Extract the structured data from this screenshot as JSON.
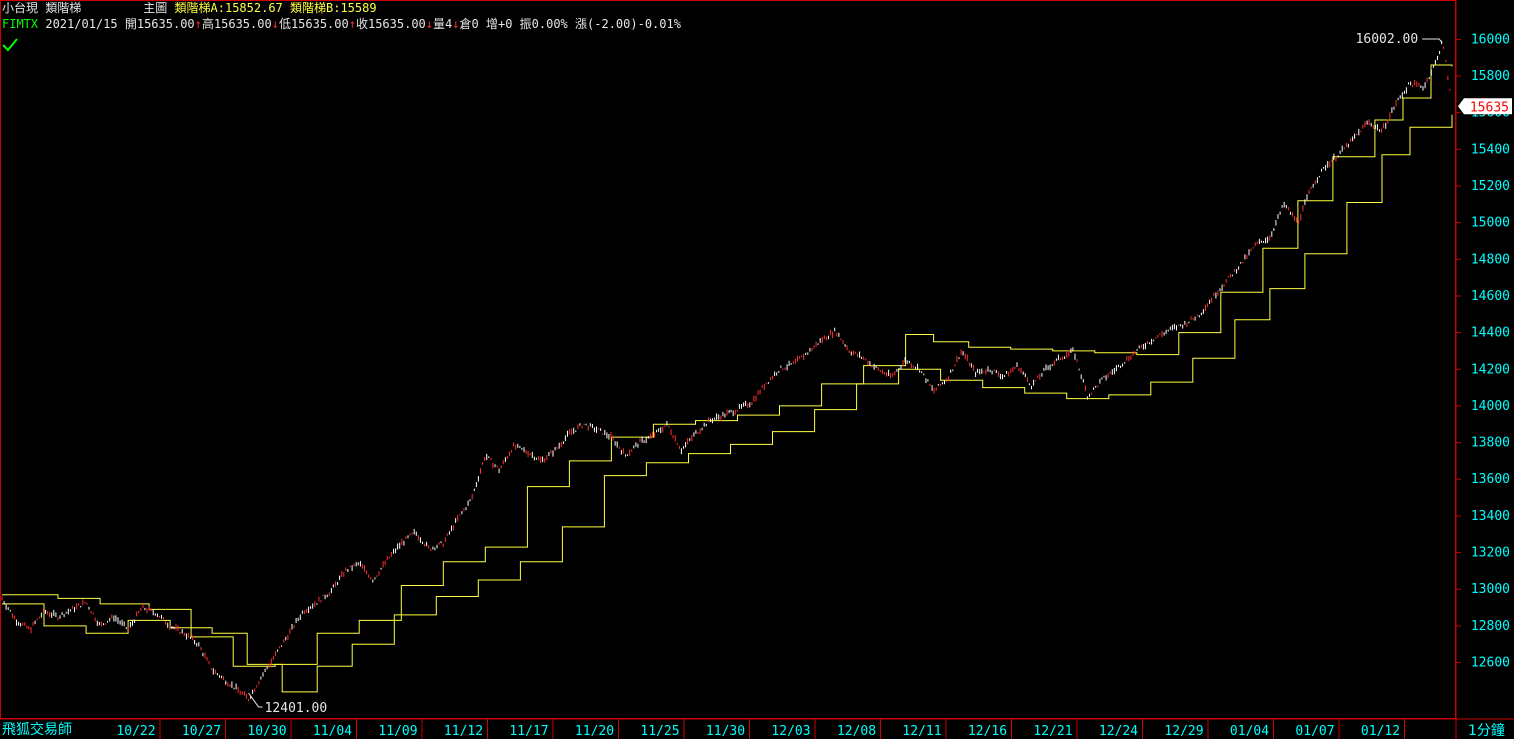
{
  "header": {
    "symbol_name": "小台現",
    "indicator_name": "類階梯",
    "panel_label": "主圖",
    "ladder_a": "類階梯A:15852.67",
    "ladder_b": "類階梯B:15589",
    "code": "FIMTX",
    "date": "2021/01/15",
    "open": "開15635.00",
    "high": "高15635.00",
    "low": "低15635.00",
    "close": "收15635.00",
    "volume": "量4",
    "oi": "倉0",
    "oi_change": "增+0",
    "amplitude": "振0.00%",
    "change": "漲(-2.00)-0.01%"
  },
  "footer": {
    "brand": "飛狐交易師",
    "interval": "1分鐘"
  },
  "colors": {
    "background": "#000000",
    "frame": "#cc0000",
    "axis_text": "#00ffff",
    "ladder_line": "#ffff40",
    "bar_up": "#ffffff",
    "bar_down": "#ff3030",
    "last_price_bg": "#ffffff",
    "last_price_text": "#ff0000",
    "check_icon": "#00ff00"
  },
  "chart_data": {
    "type": "line",
    "ylim": [
      12401,
      16002
    ],
    "y_ticks": [
      12600,
      12800,
      13000,
      13200,
      13400,
      13600,
      13800,
      14000,
      14200,
      14400,
      14600,
      14800,
      15000,
      15200,
      15400,
      15600,
      15800,
      16000
    ],
    "x_tick_labels": [
      "10/22",
      "10/27",
      "10/30",
      "11/04",
      "11/09",
      "11/12",
      "11/17",
      "11/20",
      "11/25",
      "11/30",
      "12/03",
      "12/08",
      "12/11",
      "12/16",
      "12/21",
      "12/24",
      "12/29",
      "01/04",
      "01/07",
      "01/12"
    ],
    "annotations": {
      "max_label": "16002.00",
      "min_label": "12401.00",
      "last_price_label": "15635"
    },
    "series": [
      {
        "name": "類階梯A",
        "steps": [
          [
            0,
            12970
          ],
          [
            4,
            12950
          ],
          [
            7,
            12920
          ],
          [
            10.5,
            12890
          ],
          [
            13.5,
            12740
          ],
          [
            16.5,
            12580
          ],
          [
            19.5,
            12590
          ],
          [
            22.5,
            12760
          ],
          [
            25.5,
            12830
          ],
          [
            28.5,
            13020
          ],
          [
            31.5,
            13150
          ],
          [
            34.5,
            13230
          ],
          [
            37.5,
            13560
          ],
          [
            40.5,
            13700
          ],
          [
            43.5,
            13830
          ],
          [
            46.5,
            13900
          ],
          [
            49.5,
            13920
          ],
          [
            52.5,
            13950
          ],
          [
            55.5,
            14000
          ],
          [
            58.5,
            14120
          ],
          [
            61.5,
            14220
          ],
          [
            64.5,
            14390
          ],
          [
            66.5,
            14350
          ],
          [
            69,
            14320
          ],
          [
            72,
            14310
          ],
          [
            75,
            14300
          ],
          [
            78,
            14290
          ],
          [
            81,
            14280
          ],
          [
            84,
            14400
          ],
          [
            87,
            14620
          ],
          [
            90,
            14860
          ],
          [
            92.5,
            15120
          ],
          [
            95,
            15360
          ],
          [
            98,
            15560
          ],
          [
            100,
            15680
          ],
          [
            102,
            15860
          ],
          [
            103.5,
            15852.67
          ]
        ]
      },
      {
        "name": "類階梯B",
        "steps": [
          [
            0,
            12920
          ],
          [
            3,
            12800
          ],
          [
            6,
            12760
          ],
          [
            9,
            12830
          ],
          [
            12,
            12790
          ],
          [
            15,
            12760
          ],
          [
            17.5,
            12590
          ],
          [
            20,
            12440
          ],
          [
            22.5,
            12580
          ],
          [
            25,
            12700
          ],
          [
            28,
            12860
          ],
          [
            31,
            12960
          ],
          [
            34,
            13050
          ],
          [
            37,
            13150
          ],
          [
            40,
            13340
          ],
          [
            43,
            13620
          ],
          [
            46,
            13690
          ],
          [
            49,
            13740
          ],
          [
            52,
            13790
          ],
          [
            55,
            13860
          ],
          [
            58,
            13980
          ],
          [
            61,
            14120
          ],
          [
            64,
            14200
          ],
          [
            67,
            14140
          ],
          [
            70,
            14100
          ],
          [
            73,
            14070
          ],
          [
            76,
            14040
          ],
          [
            79,
            14060
          ],
          [
            82,
            14130
          ],
          [
            85,
            14260
          ],
          [
            88,
            14470
          ],
          [
            90.5,
            14640
          ],
          [
            93,
            14830
          ],
          [
            96,
            15110
          ],
          [
            98.5,
            15370
          ],
          [
            100.5,
            15520
          ],
          [
            103.5,
            15589
          ]
        ]
      }
    ],
    "price_path": [
      [
        0,
        12950
      ],
      [
        1,
        12830
      ],
      [
        2,
        12780
      ],
      [
        3,
        12880
      ],
      [
        4,
        12850
      ],
      [
        5,
        12890
      ],
      [
        6,
        12930
      ],
      [
        7,
        12800
      ],
      [
        8,
        12850
      ],
      [
        9,
        12780
      ],
      [
        10,
        12900
      ],
      [
        11,
        12870
      ],
      [
        12,
        12800
      ],
      [
        13,
        12760
      ],
      [
        14,
        12700
      ],
      [
        15,
        12560
      ],
      [
        16,
        12500
      ],
      [
        17,
        12440
      ],
      [
        17.6,
        12401
      ],
      [
        18.5,
        12520
      ],
      [
        19.5,
        12640
      ],
      [
        20.5,
        12760
      ],
      [
        21.5,
        12880
      ],
      [
        22.5,
        12930
      ],
      [
        23.5,
        12990
      ],
      [
        24.5,
        13100
      ],
      [
        25.5,
        13140
      ],
      [
        26.5,
        13050
      ],
      [
        27.5,
        13160
      ],
      [
        28.5,
        13250
      ],
      [
        29.5,
        13310
      ],
      [
        30.5,
        13220
      ],
      [
        31.5,
        13250
      ],
      [
        32.5,
        13380
      ],
      [
        33.5,
        13490
      ],
      [
        34.5,
        13730
      ],
      [
        35.5,
        13650
      ],
      [
        36.5,
        13780
      ],
      [
        37.5,
        13750
      ],
      [
        38.5,
        13700
      ],
      [
        39.5,
        13760
      ],
      [
        40.5,
        13850
      ],
      [
        41.5,
        13900
      ],
      [
        42.5,
        13870
      ],
      [
        43.5,
        13830
      ],
      [
        44.5,
        13730
      ],
      [
        45.5,
        13800
      ],
      [
        46.5,
        13840
      ],
      [
        47.5,
        13900
      ],
      [
        48.5,
        13760
      ],
      [
        49.5,
        13850
      ],
      [
        50.5,
        13920
      ],
      [
        51.5,
        13950
      ],
      [
        52.5,
        13980
      ],
      [
        53.5,
        14020
      ],
      [
        54.5,
        14120
      ],
      [
        55.5,
        14200
      ],
      [
        56.5,
        14230
      ],
      [
        57.5,
        14290
      ],
      [
        58.5,
        14360
      ],
      [
        59.5,
        14410
      ],
      [
        60.5,
        14300
      ],
      [
        61.5,
        14260
      ],
      [
        62.5,
        14200
      ],
      [
        63.5,
        14160
      ],
      [
        64.5,
        14250
      ],
      [
        65.5,
        14200
      ],
      [
        66.5,
        14080
      ],
      [
        67.5,
        14150
      ],
      [
        68.5,
        14300
      ],
      [
        69.5,
        14180
      ],
      [
        70.5,
        14200
      ],
      [
        71.5,
        14160
      ],
      [
        72.5,
        14220
      ],
      [
        73.5,
        14110
      ],
      [
        74.5,
        14200
      ],
      [
        75.5,
        14260
      ],
      [
        76.5,
        14300
      ],
      [
        77.5,
        14050
      ],
      [
        78.5,
        14140
      ],
      [
        79.5,
        14200
      ],
      [
        80.5,
        14270
      ],
      [
        81.5,
        14330
      ],
      [
        82.5,
        14380
      ],
      [
        83.5,
        14420
      ],
      [
        84.5,
        14450
      ],
      [
        85.5,
        14500
      ],
      [
        86.5,
        14600
      ],
      [
        87.5,
        14690
      ],
      [
        88.5,
        14780
      ],
      [
        89.5,
        14880
      ],
      [
        90.5,
        14920
      ],
      [
        91.5,
        15100
      ],
      [
        92.5,
        15000
      ],
      [
        93.5,
        15200
      ],
      [
        94.5,
        15310
      ],
      [
        95.5,
        15380
      ],
      [
        96.5,
        15460
      ],
      [
        97.5,
        15550
      ],
      [
        98.5,
        15500
      ],
      [
        99.5,
        15650
      ],
      [
        100.5,
        15760
      ],
      [
        101.5,
        15740
      ],
      [
        102.5,
        15900
      ],
      [
        102.8,
        16002
      ],
      [
        103.2,
        15800
      ],
      [
        103.5,
        15635
      ]
    ]
  }
}
